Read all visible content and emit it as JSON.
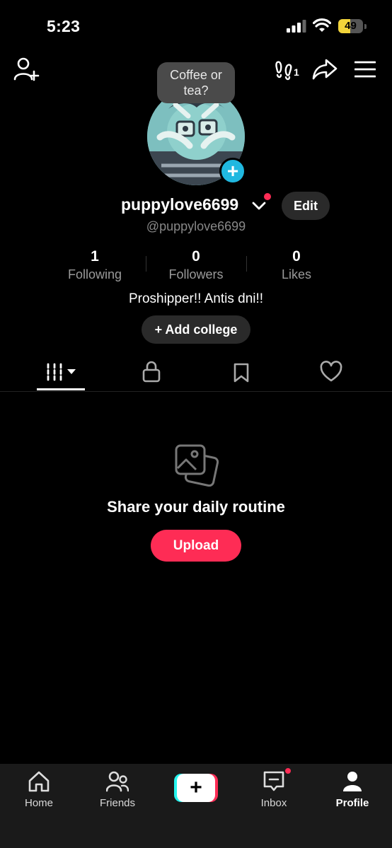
{
  "status_bar": {
    "time": "5:23",
    "battery": "49",
    "battery_level": 0.49
  },
  "top_bar": {
    "footprint_count": "1"
  },
  "profile": {
    "bubble_text_line1": "Coffee or",
    "bubble_text_line2": "tea?",
    "username": "puppylove6699",
    "handle": "@puppylove6699",
    "edit_label": "Edit",
    "bio": "Proshipper!! Antis dni!!",
    "add_college_label": "+ Add college"
  },
  "stats": [
    {
      "value": "1",
      "label": "Following"
    },
    {
      "value": "0",
      "label": "Followers"
    },
    {
      "value": "0",
      "label": "Likes"
    }
  ],
  "tabs": [
    {
      "icon": "grid-icon",
      "active": true
    },
    {
      "icon": "lock-icon",
      "active": false
    },
    {
      "icon": "bookmark-icon",
      "active": false
    },
    {
      "icon": "heart-icon",
      "active": false
    }
  ],
  "empty_state": {
    "icon": "photos-icon",
    "title": "Share your daily routine",
    "button_label": "Upload"
  },
  "bottom_nav": [
    {
      "label": "Home",
      "icon": "home-icon"
    },
    {
      "label": "Friends",
      "icon": "friends-icon"
    },
    {
      "label": "",
      "icon": "create-plus-icon"
    },
    {
      "label": "Inbox",
      "icon": "inbox-icon"
    },
    {
      "label": "Profile",
      "icon": "profile-icon"
    }
  ],
  "colors": {
    "accent": "#fe2c55",
    "avatar_plus": "#20b8e0",
    "battery": "#f2d43a",
    "bg": "#000000"
  }
}
